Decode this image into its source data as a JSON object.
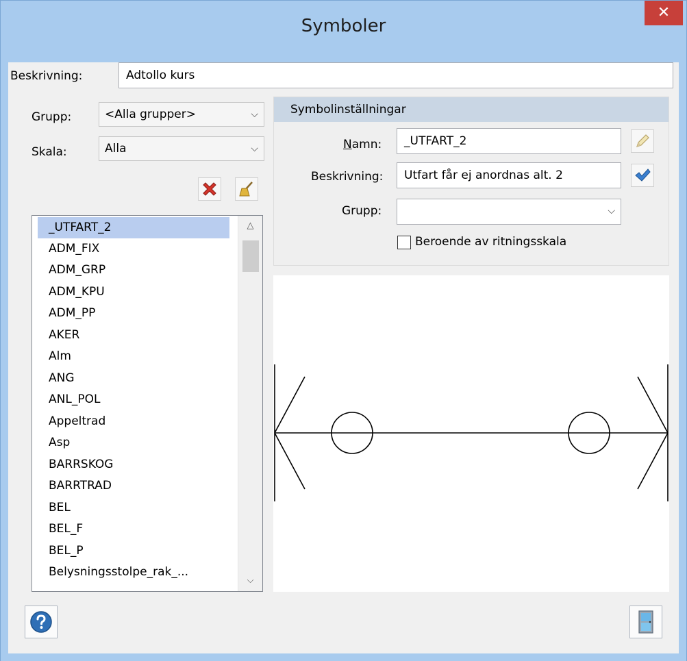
{
  "window": {
    "title": "Symboler",
    "close_label": "✕"
  },
  "beskrivning": {
    "label": "Beskrivning:",
    "value": "Adtollo kurs"
  },
  "filter": {
    "grupp_label": "Grupp:",
    "grupp_value": "<Alla grupper>",
    "skala_label": "Skala:",
    "skala_value": "Alla",
    "delete_icon": "red-x-delete-icon",
    "clear_icon": "broom-icon"
  },
  "symbol_list": {
    "items": [
      "_UTFART_2",
      "ADM_FIX",
      "ADM_GRP",
      "ADM_KPU",
      "ADM_PP",
      "AKER",
      "Alm",
      "ANG",
      "ANL_POL",
      "Appeltrad",
      "Asp",
      "BARRSKOG",
      "BARRTRAD",
      "BEL",
      "BEL_F",
      "BEL_P",
      "Belysningsstolpe_rak_..."
    ],
    "selected_index": 0
  },
  "settings": {
    "header": "Symbolinställningar",
    "namn_label_prefix": "",
    "namn_label_mnemonic": "N",
    "namn_label_rest": "amn:",
    "namn_value": "_UTFART_2",
    "beskrivning_label": "Beskrivning:",
    "beskrivning_value": "Utfart får ej anordnas alt. 2",
    "grupp_label": "Grupp:",
    "grupp_value": "",
    "checkbox_label": "Beroende av ritningsskala",
    "checkbox_checked": false
  },
  "colors": {
    "titlebar": "#a8cbee",
    "close": "#c7403a",
    "selection": "#b9cdef",
    "panel_header": "#c9d6e4"
  }
}
